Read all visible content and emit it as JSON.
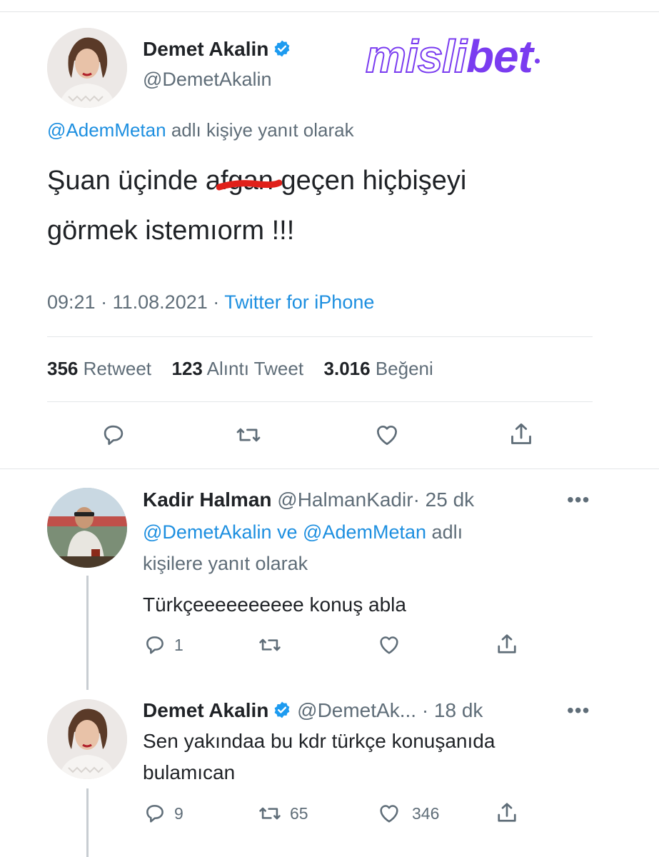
{
  "watermark": {
    "part1": "misli",
    "part2": "bet",
    "color": "#7a3cf0"
  },
  "main_tweet": {
    "author_name": "Demet Akalin",
    "author_handle": "@DemetAkalin",
    "reply_context_handle": "@AdemMetan",
    "reply_context_text": "adlı kişiye yanıt olarak",
    "text_line1_before": "Şuan üçinde a",
    "text_line1_redacted": "fgan",
    "text_line1_after": " geçen hiçbişeyi",
    "text_line2": "görmek istemıorm !!!",
    "time": "09:21",
    "date": "11.08.2021",
    "source": "Twitter for iPhone",
    "stats": {
      "retweets_count": "356",
      "retweets_label": "Retweet",
      "quotes_count": "123",
      "quotes_label": "Alıntı Tweet",
      "likes_count": "3.016",
      "likes_label": "Beğeni"
    }
  },
  "reply1": {
    "author_name": "Kadir Halman",
    "author_handle": "@HalmanKadir",
    "time_ago": "· 25 dk",
    "context_handle1": "@DemetAkalin",
    "context_joiner": "ve",
    "context_handle2": "@AdemMetan",
    "context_text1": "adlı",
    "context_text2": "kişilere yanıt olarak",
    "text": "Türkçeeeeeeeeee konuş abla",
    "reply_count": "1",
    "retweet_count": "",
    "like_count": ""
  },
  "reply2": {
    "author_name": "Demet Akalin",
    "author_handle": "@DemetAk...",
    "time_ago": "· 18 dk",
    "text_line1": "Sen yakındaa bu kdr türkçe konuşanıda",
    "text_line2": "bulamıcan",
    "reply_count": "9",
    "retweet_count": "65",
    "like_count": "346"
  },
  "colors": {
    "link": "#1d8fe0",
    "muted": "#5f6d78",
    "verified": "#1d9bf0",
    "redaction": "#e0201a"
  }
}
